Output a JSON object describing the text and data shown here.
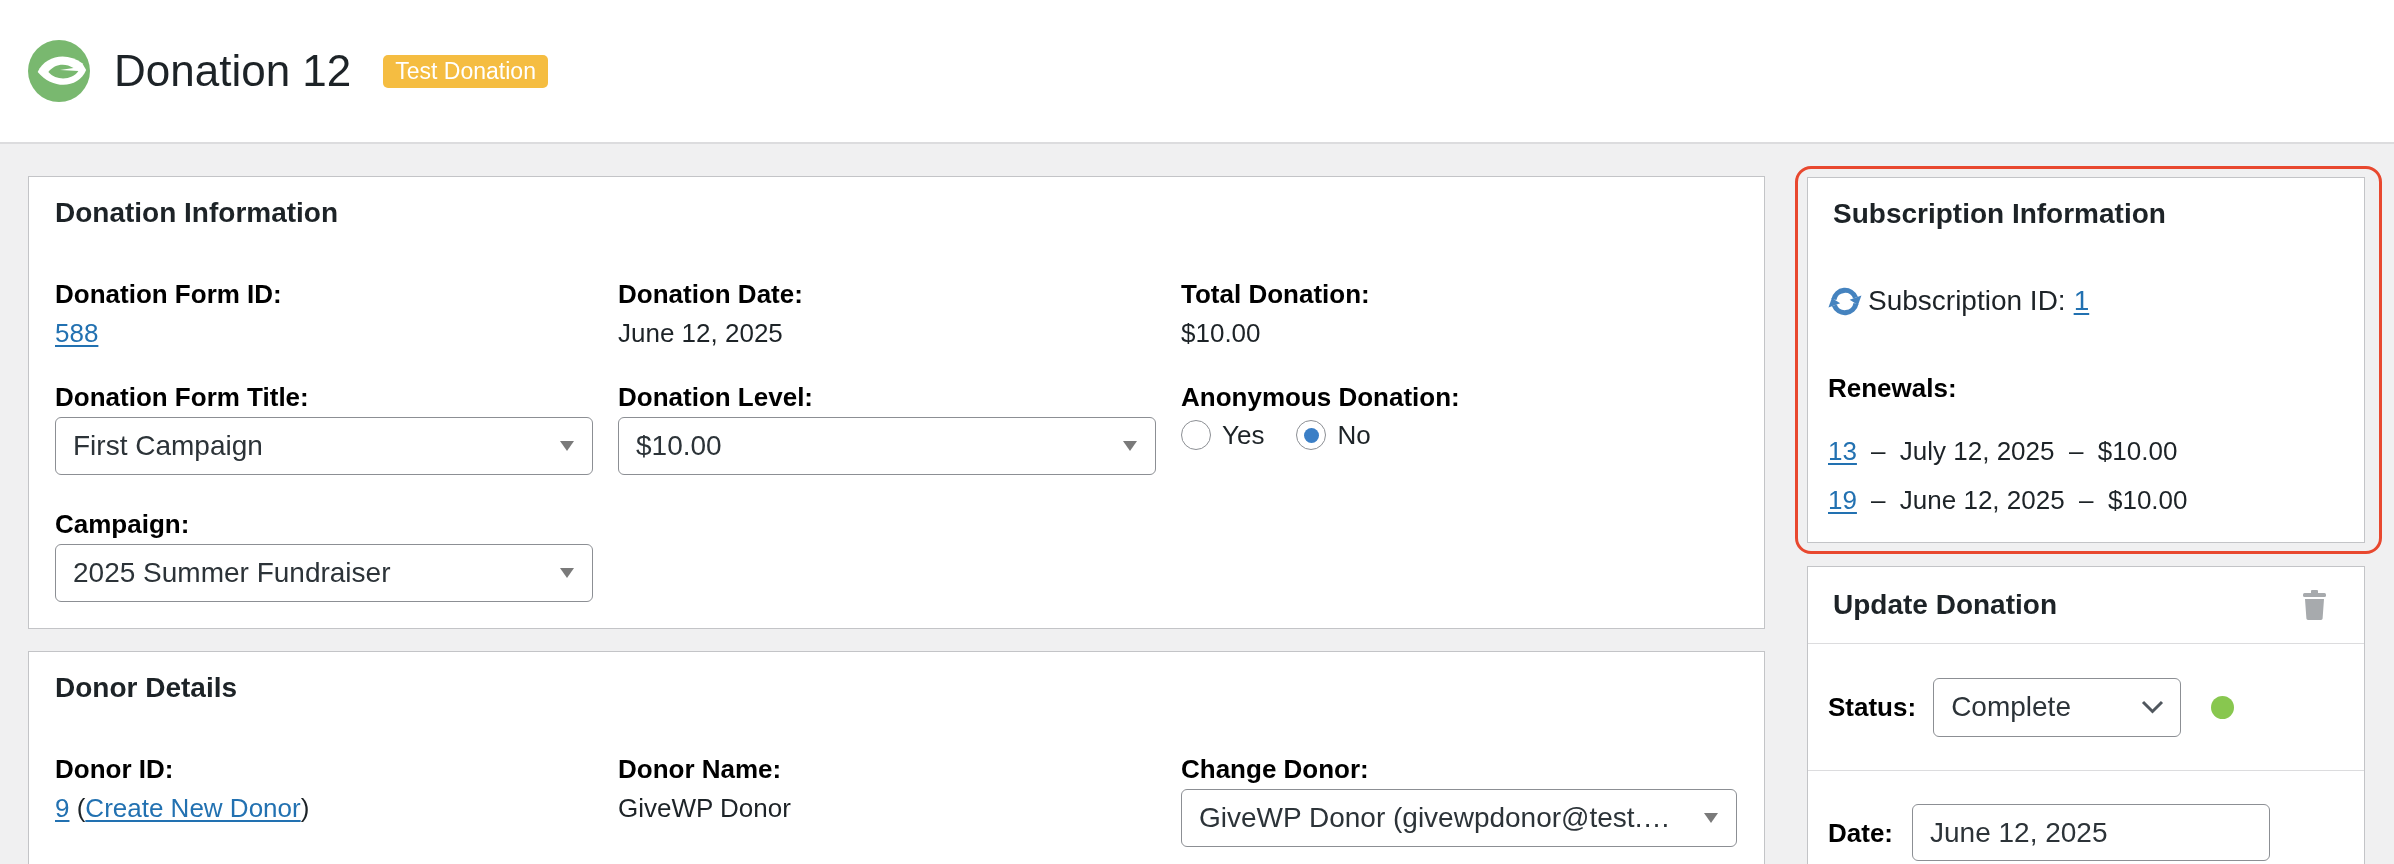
{
  "header": {
    "title": "Donation 12",
    "badge": "Test Donation"
  },
  "donation_info": {
    "title": "Donation Information",
    "fields": [
      {
        "kind": "link",
        "label": "Donation Form ID:",
        "value": "588"
      },
      {
        "kind": "text",
        "label": "Donation Date:",
        "value": "June 12, 2025"
      },
      {
        "kind": "text",
        "label": "Total Donation:",
        "value": "$10.00"
      },
      {
        "kind": "select",
        "label": "Donation Form Title:",
        "value": "First Campaign"
      },
      {
        "kind": "select",
        "label": "Donation Level:",
        "value": "$10.00"
      },
      {
        "kind": "radio",
        "label": "Anonymous Donation:",
        "options": [
          {
            "label": "Yes",
            "selected": false
          },
          {
            "label": "No",
            "selected": true
          }
        ]
      },
      {
        "kind": "select",
        "label": "Campaign:",
        "value": "2025 Summer Fundraiser"
      }
    ]
  },
  "donor_details": {
    "title": "Donor Details",
    "fields": [
      {
        "kind": "parts",
        "label": "Donor ID:",
        "parts": [
          {
            "kind": "link",
            "text": "9"
          },
          {
            "kind": "text",
            "text": " ("
          },
          {
            "kind": "link",
            "text": "Create New Donor"
          },
          {
            "kind": "text",
            "text": ")"
          }
        ]
      },
      {
        "kind": "text",
        "label": "Donor Name:",
        "value": "GiveWP Donor"
      },
      {
        "kind": "select",
        "label": "Change Donor:",
        "value": "GiveWP Donor (givewpdonor@test.…"
      }
    ]
  },
  "subscription": {
    "title": "Subscription Information",
    "highlighted": true,
    "id_label": "Subscription ID:",
    "id": "1",
    "renewals_label": "Renewals:",
    "renewals": [
      {
        "id": "13",
        "details": "–  July 12, 2025  –  $10.00"
      },
      {
        "id": "19",
        "details": "–  June 12, 2025  –  $10.00"
      }
    ]
  },
  "update_donation": {
    "title": "Update Donation",
    "status": {
      "label": "Status:",
      "value": "Complete",
      "color": "#88c74f"
    },
    "date": {
      "label": "Date:",
      "value": "June 12, 2025"
    }
  }
}
